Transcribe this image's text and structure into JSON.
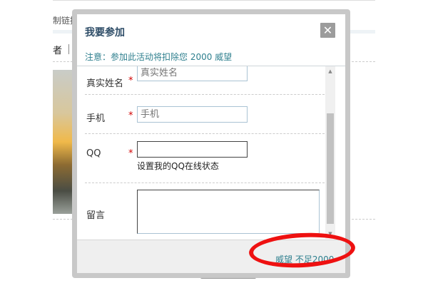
{
  "background": {
    "link_text": "制链接",
    "tab_text": "者"
  },
  "dialog": {
    "title": "我要参加",
    "close_icon": "close-icon",
    "notice": "注意：参加此活动将扣除您 2000 威望",
    "fields": {
      "name": {
        "label": "真实姓名",
        "required_mark": "*",
        "placeholder": "真实姓名"
      },
      "phone": {
        "label": "手机",
        "required_mark": "*",
        "placeholder": "手机"
      },
      "qq": {
        "label": "QQ",
        "required_mark": "*",
        "placeholder": "",
        "tip": "设置我的QQ在线状态"
      },
      "message": {
        "label": "留言",
        "placeholder": ""
      }
    },
    "footer_text": "威望 不足2000",
    "annotation_color": "#ee1111"
  }
}
